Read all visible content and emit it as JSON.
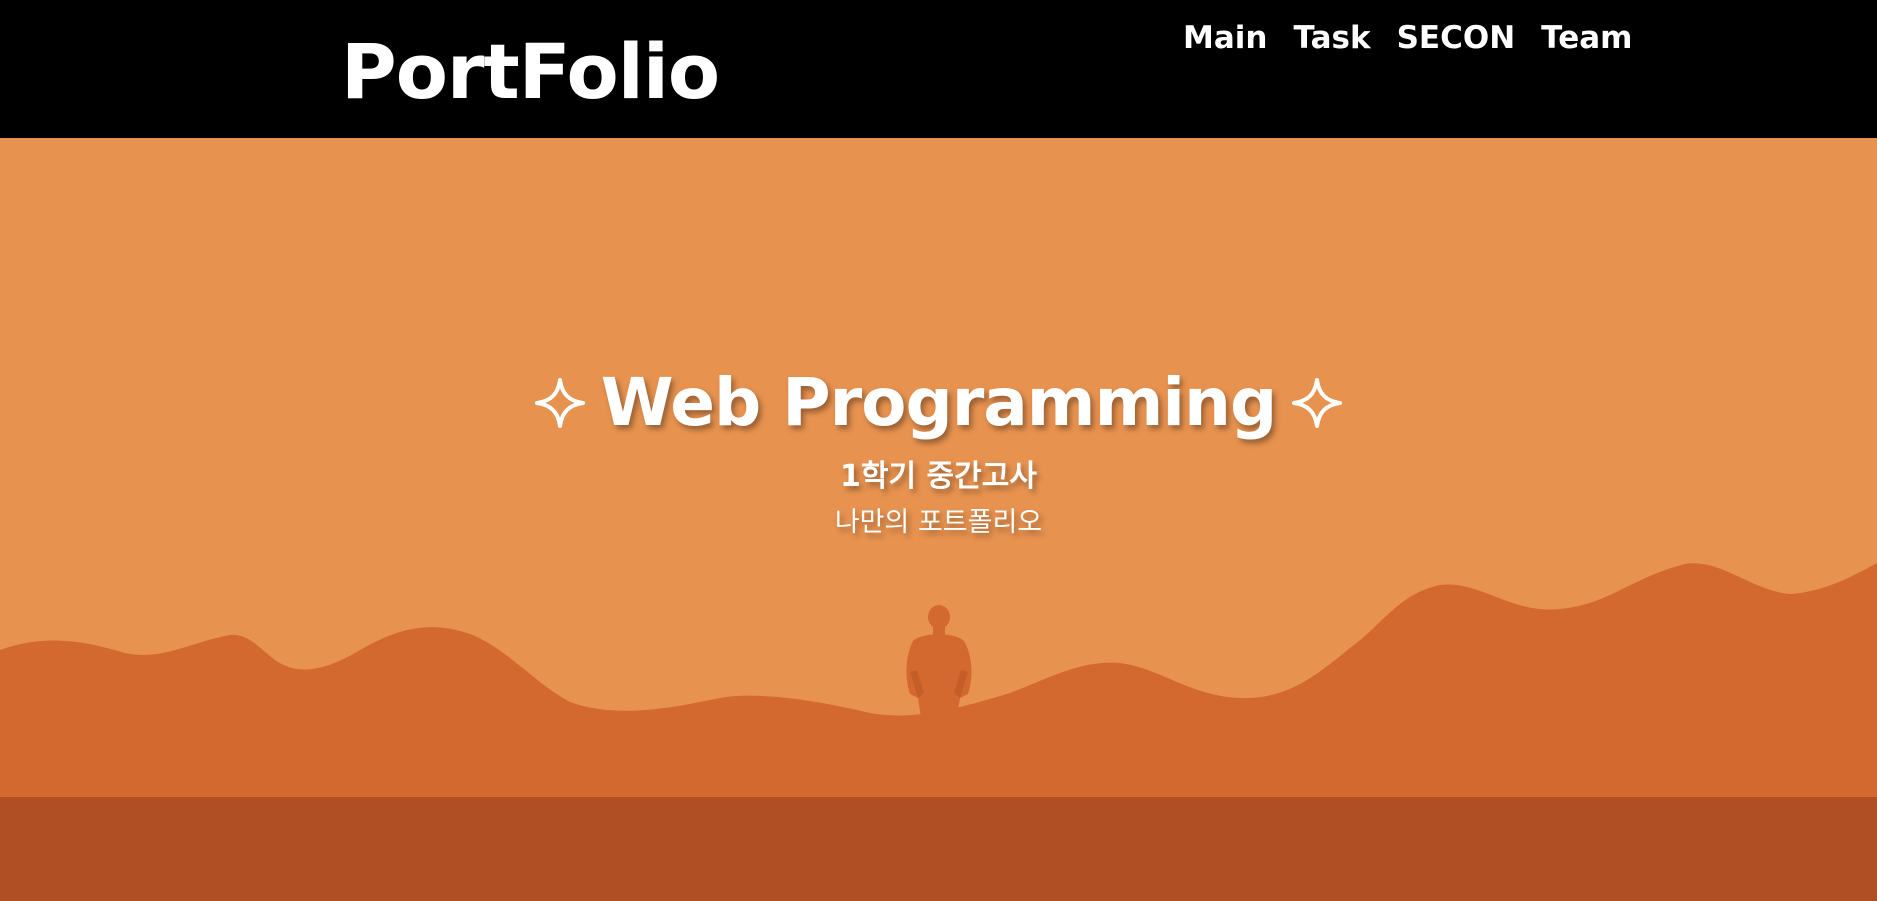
{
  "header": {
    "logo": "PortFolio",
    "nav": [
      {
        "label": "Main"
      },
      {
        "label": "Task"
      },
      {
        "label": "SECON"
      },
      {
        "label": "Team"
      }
    ]
  },
  "hero": {
    "title": "Web Programming",
    "title_decoration_icon": "sparkle-icon",
    "subtitle": "1학기 중간고사",
    "description": "나만의 포트폴리오"
  },
  "colors": {
    "header_bg": "#000000",
    "sky": "#e8924f",
    "hills": "#d4692f",
    "ground": "#b04f23",
    "text": "#ffffff"
  }
}
